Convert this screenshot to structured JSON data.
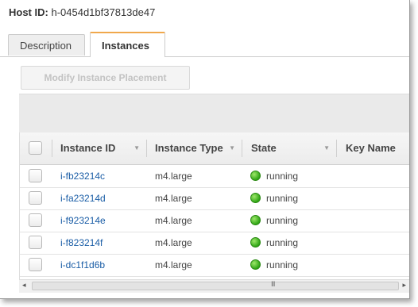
{
  "host": {
    "label": "Host ID:",
    "value": "h-0454d1bf37813de47"
  },
  "tabs": [
    {
      "label": "Description",
      "active": false
    },
    {
      "label": "Instances",
      "active": true
    }
  ],
  "toolbar": {
    "modify_label": "Modify Instance Placement",
    "modify_enabled": false
  },
  "table": {
    "columns": [
      "Instance ID",
      "Instance Type",
      "State",
      "Key Name"
    ],
    "rows": [
      {
        "id": "i-fb23214c",
        "type": "m4.large",
        "state": "running"
      },
      {
        "id": "i-fa23214d",
        "type": "m4.large",
        "state": "running"
      },
      {
        "id": "i-f923214e",
        "type": "m4.large",
        "state": "running"
      },
      {
        "id": "i-f823214f",
        "type": "m4.large",
        "state": "running"
      },
      {
        "id": "i-dc1f1d6b",
        "type": "m4.large",
        "state": "running"
      }
    ]
  },
  "scrollbar": {
    "left_arrow": "◂",
    "right_arrow": "▸",
    "grip": "III"
  },
  "icons": {
    "sort": "▼",
    "state_running": "green-circle"
  },
  "colors": {
    "active_tab_accent": "#f0a84c",
    "link": "#1a5da6",
    "running": "#2fa515"
  }
}
